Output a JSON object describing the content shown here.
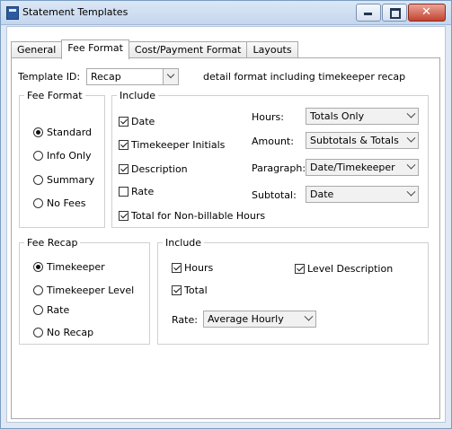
{
  "window": {
    "title": "Statement Templates"
  },
  "tabs": [
    {
      "label": "General"
    },
    {
      "label": "Fee Format"
    },
    {
      "label": "Cost/Payment Format"
    },
    {
      "label": "Layouts"
    }
  ],
  "template": {
    "label": "Template ID:",
    "value": "Recap",
    "description": "detail format including timekeeper recap"
  },
  "fee_format": {
    "title": "Fee Format",
    "options": [
      "Standard",
      "Info Only",
      "Summary",
      "No Fees"
    ],
    "selected": "Standard"
  },
  "include": {
    "title": "Include",
    "checks": [
      {
        "label": "Date",
        "checked": true
      },
      {
        "label": "Timekeeper Initials",
        "checked": true
      },
      {
        "label": "Description",
        "checked": true
      },
      {
        "label": "Rate",
        "checked": false
      },
      {
        "label": "Total for Non-billable Hours",
        "checked": true
      }
    ],
    "fields": [
      {
        "label": "Hours:",
        "value": "Totals Only"
      },
      {
        "label": "Amount:",
        "value": "Subtotals & Totals"
      },
      {
        "label": "Paragraph:",
        "value": "Date/Timekeeper"
      },
      {
        "label": "Subtotal:",
        "value": "Date"
      }
    ]
  },
  "fee_recap": {
    "title": "Fee Recap",
    "options": [
      "Timekeeper",
      "Timekeeper Level",
      "Rate",
      "No Recap"
    ],
    "selected": "Timekeeper"
  },
  "recap_include": {
    "title": "Include",
    "checks": [
      {
        "label": "Hours",
        "checked": true
      },
      {
        "label": "Level Description",
        "checked": true
      },
      {
        "label": "Total",
        "checked": true
      }
    ],
    "rate_label": "Rate:",
    "rate_value": "Average Hourly"
  }
}
